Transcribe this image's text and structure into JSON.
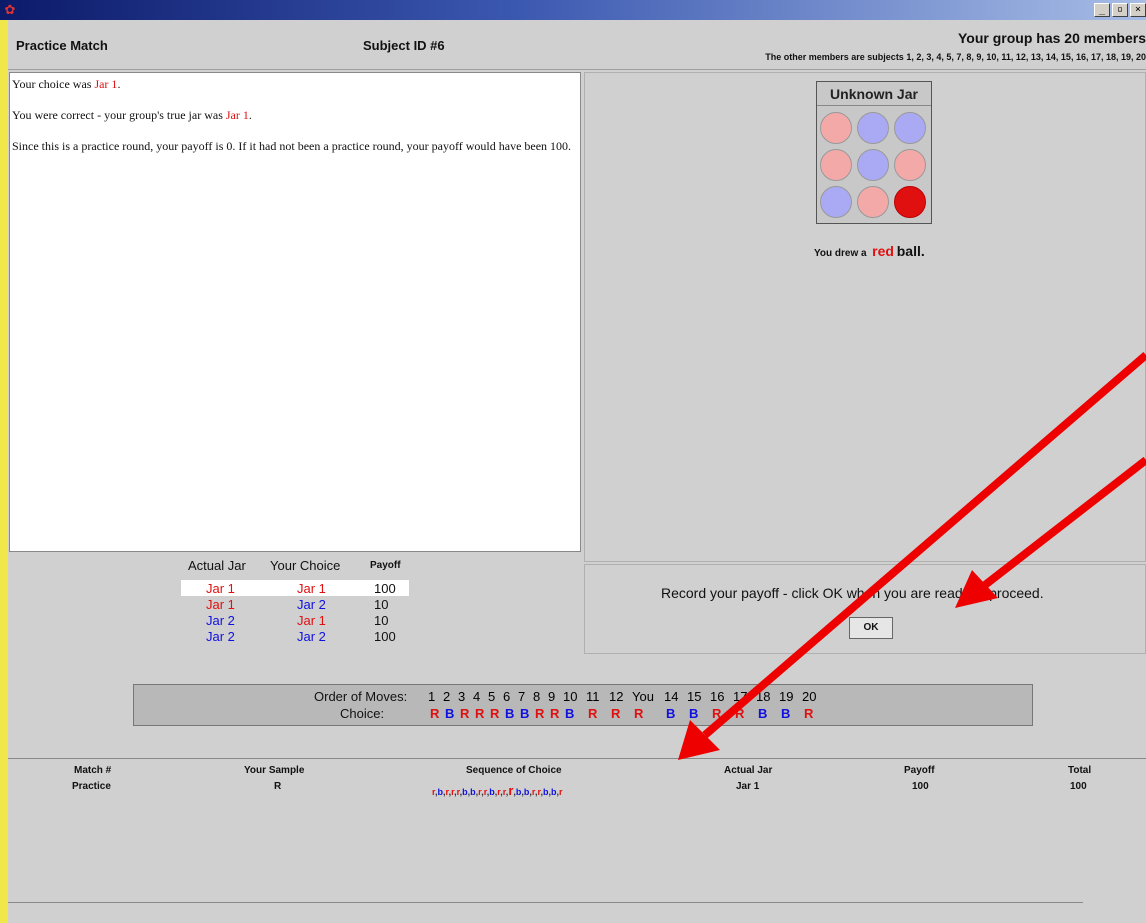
{
  "window": {
    "title_icon": "app-icon",
    "controls": [
      "minimize",
      "maximize",
      "close"
    ]
  },
  "header": {
    "title": "Practice Match",
    "subject": "Subject ID #6",
    "group": "Your group has 20 members",
    "members": "The other members are subjects 1, 2, 3, 4, 5, 7, 8, 9, 10, 11, 12, 13, 14, 15, 16, 17, 18, 19, 20"
  },
  "message": {
    "line1_prefix": "Your choice was ",
    "line1_jar": "Jar 1",
    "line1_suffix": ".",
    "line2_prefix": "You were correct - your group's true jar was ",
    "line2_jar": "Jar 1",
    "line2_suffix": ".",
    "line3": "Since this is a practice round, your payoff is 0.  If it had not been a practice round, your payoff would have been 100."
  },
  "jar": {
    "title": "Unknown Jar",
    "balls": [
      "pink",
      "lavender",
      "lavender",
      "pink",
      "lavender",
      "pink",
      "lavender",
      "pink",
      "red"
    ],
    "drew_prefix": "You drew a",
    "drew_color": "red",
    "drew_suffix": "ball."
  },
  "payoff_table": {
    "headers": {
      "actual": "Actual Jar",
      "choice": "Your Choice",
      "payoff": "Payoff"
    },
    "rows": [
      {
        "actual": "Jar 1",
        "choice": "Jar 1",
        "payoff": "100"
      },
      {
        "actual": "Jar 1",
        "choice": "Jar 2",
        "payoff": "10"
      },
      {
        "actual": "Jar 2",
        "choice": "Jar 1",
        "payoff": "10"
      },
      {
        "actual": "Jar 2",
        "choice": "Jar 2",
        "payoff": "100"
      }
    ]
  },
  "record": {
    "text": "Record your payoff - click OK when you are ready to proceed.",
    "ok_label": "OK"
  },
  "order": {
    "moves_label": "Order of Moves:",
    "choice_label": "Choice:",
    "moves": [
      "1",
      "2",
      "3",
      "4",
      "5",
      "6",
      "7",
      "8",
      "9",
      "10",
      "11",
      "12",
      "You",
      "14",
      "15",
      "16",
      "17",
      "18",
      "19",
      "20"
    ],
    "choices": [
      "R",
      "B",
      "R",
      "R",
      "R",
      "B",
      "B",
      "R",
      "R",
      "B",
      "R",
      "R",
      "R",
      "B",
      "B",
      "R",
      "R",
      "B",
      "B",
      "R"
    ]
  },
  "history": {
    "headers": {
      "match": "Match #",
      "sample": "Your Sample",
      "sequence": "Sequence of Choice",
      "actual": "Actual Jar",
      "payoff": "Payoff",
      "total": "Total"
    },
    "rows": [
      {
        "match": "Practice",
        "sample": "R",
        "sequence": "r,b,r,r,r,b,b,r,r,b,r,r,R,b,b,r,r,b,b,r",
        "actual": "Jar 1",
        "payoff": "100",
        "total": "100"
      }
    ]
  },
  "colors": {
    "red": "#e01010",
    "blue": "#1010e0",
    "pink": "#f4a9a9",
    "lavender": "#aaaaf4",
    "panel": "#d0d0d0",
    "desktop": "#f0e84a"
  }
}
